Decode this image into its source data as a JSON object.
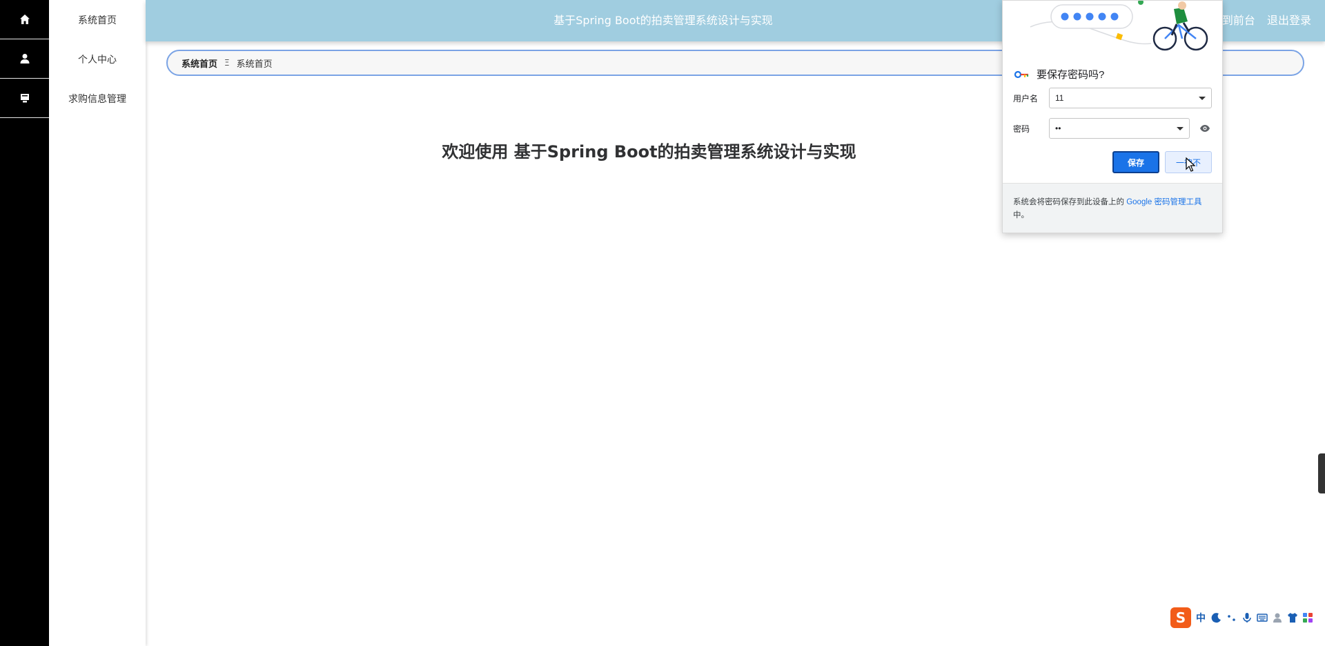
{
  "icon_rail": {
    "items": [
      {
        "icon": "home-icon"
      },
      {
        "icon": "user-icon"
      },
      {
        "icon": "inbox-icon"
      }
    ]
  },
  "side_menu": {
    "items": [
      {
        "label": "系统首页"
      },
      {
        "label": "个人中心"
      },
      {
        "label": "求购信息管理"
      }
    ]
  },
  "header": {
    "title": "基于Spring Boot的拍卖管理系统设计与实现",
    "front_link": "到前台",
    "logout_link": "退出登录"
  },
  "breadcrumb": {
    "root": "系统首页",
    "separator": "Ξ",
    "current": "系统首页"
  },
  "main": {
    "welcome": "欢迎使用 基于Spring Boot的拍卖管理系统设计与实现"
  },
  "password_popup": {
    "title": "要保存密码吗?",
    "username_label": "用户名",
    "username_value": "11",
    "password_label": "密码",
    "password_value": "••",
    "save_button": "保存",
    "never_button": "一律不",
    "footer_prefix": "系统会将密码保存到此设备上的 ",
    "footer_link": "Google 密码管理工具",
    "footer_suffix": "中。",
    "accent_color": "#1a73e8"
  },
  "ime_bar": {
    "logo": "S",
    "mode": "中",
    "icons": [
      "moon-icon",
      "punctuation-icon",
      "microphone-icon",
      "keyboard-icon",
      "person-icon",
      "shirt-icon",
      "grid-icon"
    ]
  },
  "colors": {
    "header_bg": "#a0cde0",
    "rail_bg": "#000000",
    "breadcrumb_border": "#7aa3e5"
  }
}
